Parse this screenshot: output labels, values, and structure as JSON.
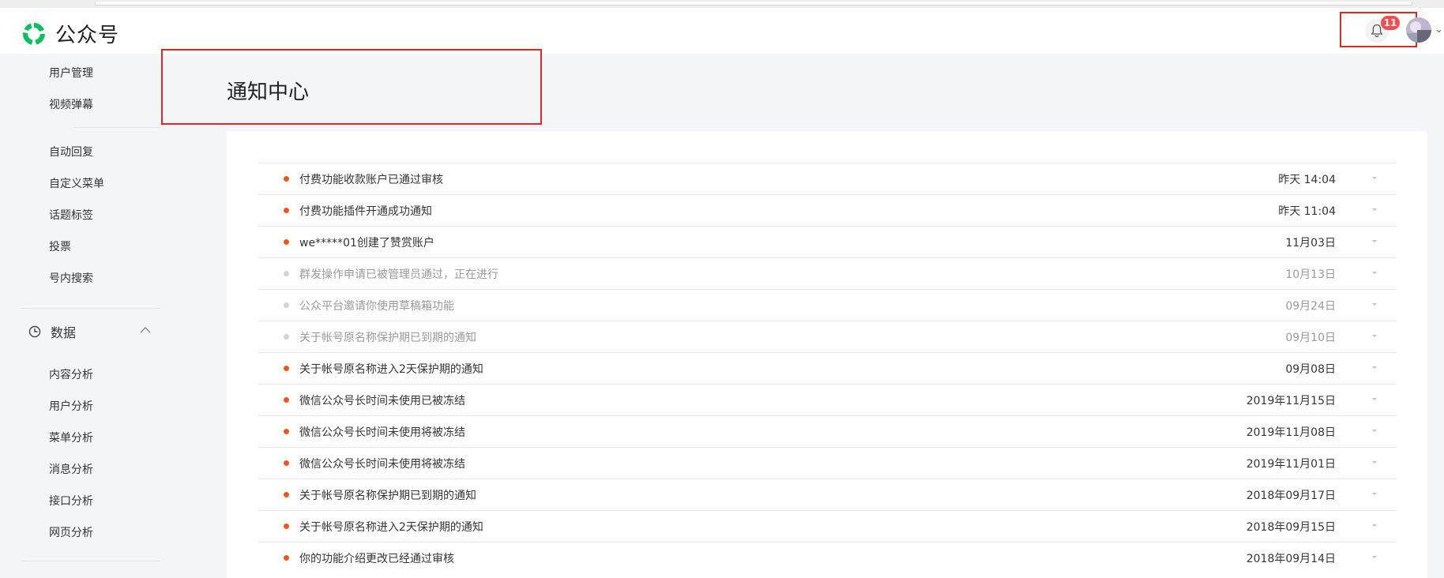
{
  "app": {
    "name": "公众号"
  },
  "header": {
    "notification_count": "11"
  },
  "sidebar": {
    "items_top": [
      "用户管理",
      "视频弹幕"
    ],
    "items_mid": [
      "自动回复",
      "自定义菜单",
      "话题标签",
      "投票",
      "号内搜索"
    ],
    "section": {
      "label": "数据",
      "icon": "clock-icon",
      "expanded": true
    },
    "items_data": [
      "内容分析",
      "用户分析",
      "菜单分析",
      "消息分析",
      "接口分析",
      "网页分析"
    ]
  },
  "page": {
    "title": "通知中心"
  },
  "notifications": [
    {
      "title": "付费功能收款账户已通过审核",
      "time": "昨天 14:04",
      "unread": true
    },
    {
      "title": "付费功能插件开通成功通知",
      "time": "昨天 11:04",
      "unread": true
    },
    {
      "title": "we*****01创建了赞赏账户",
      "time": "11月03日",
      "unread": true
    },
    {
      "title": "群发操作申请已被管理员通过，正在进行",
      "time": "10月13日",
      "unread": false
    },
    {
      "title": "公众平台邀请你使用草稿箱功能",
      "time": "09月24日",
      "unread": false
    },
    {
      "title": "关于帐号原名称保护期已到期的通知",
      "time": "09月10日",
      "unread": false
    },
    {
      "title": "关于帐号原名称进入2天保护期的通知",
      "time": "09月08日",
      "unread": true
    },
    {
      "title": "微信公众号长时间未使用已被冻结",
      "time": "2019年11月15日",
      "unread": true
    },
    {
      "title": "微信公众号长时间未使用将被冻结",
      "time": "2019年11月08日",
      "unread": true
    },
    {
      "title": "微信公众号长时间未使用将被冻结",
      "time": "2019年11月01日",
      "unread": true
    },
    {
      "title": "关于帐号原名称保护期已到期的通知",
      "time": "2018年09月17日",
      "unread": true
    },
    {
      "title": "关于帐号原名称进入2天保护期的通知",
      "time": "2018年09月15日",
      "unread": true
    },
    {
      "title": "你的功能介绍更改已经通过审核",
      "time": "2018年09月14日",
      "unread": true
    }
  ],
  "colors": {
    "accent_red": "#e0261f",
    "unread_dot": "#f25418",
    "brand_green": "#07c160"
  }
}
